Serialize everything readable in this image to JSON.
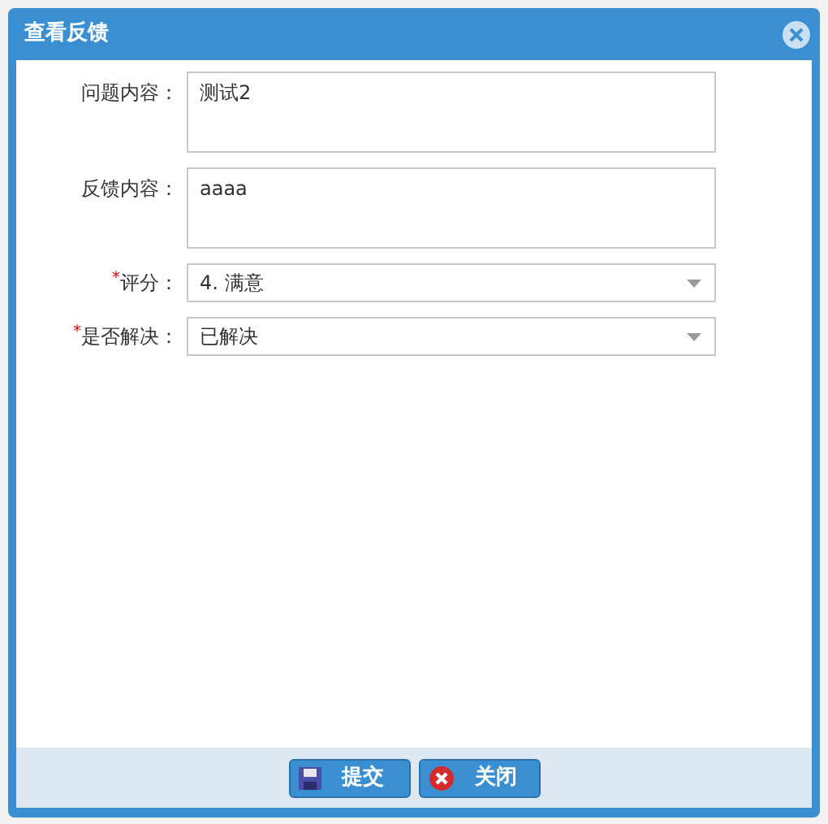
{
  "window": {
    "title": "查看反馈"
  },
  "fields": [
    {
      "kind": "textarea",
      "label": "问题内容：",
      "value": "测试2"
    },
    {
      "kind": "textarea",
      "label": "反馈内容：",
      "value": "aaaa"
    },
    {
      "kind": "select",
      "required_mark": "*",
      "label": "评分：",
      "value": "4. 满意"
    },
    {
      "kind": "select",
      "required_mark": "*",
      "label": "是否解决：",
      "value": "已解决"
    }
  ],
  "buttons": [
    {
      "kind": "save",
      "label": "提交"
    },
    {
      "kind": "close",
      "label": "关闭"
    }
  ]
}
